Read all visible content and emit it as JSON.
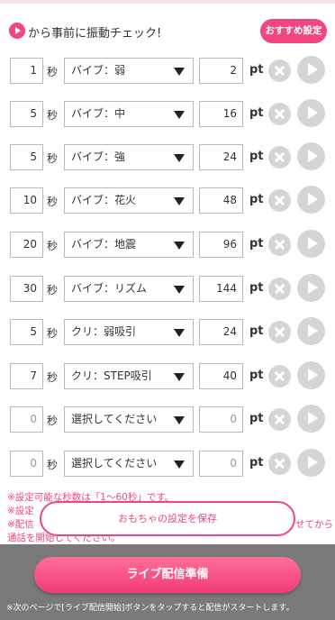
{
  "header": {
    "intro_text": "から事前に振動チェック!",
    "recommend_label": "おすすめ設定"
  },
  "units": {
    "sec": "秒",
    "pt": "pt"
  },
  "rows": [
    {
      "seconds": "1",
      "pattern": "バイブ：弱",
      "points": "2"
    },
    {
      "seconds": "5",
      "pattern": "バイブ：中",
      "points": "16"
    },
    {
      "seconds": "5",
      "pattern": "バイブ：強",
      "points": "24"
    },
    {
      "seconds": "10",
      "pattern": "バイブ：花火",
      "points": "48"
    },
    {
      "seconds": "20",
      "pattern": "バイブ：地震",
      "points": "96"
    },
    {
      "seconds": "30",
      "pattern": "バイブ：リズム",
      "points": "144"
    },
    {
      "seconds": "5",
      "pattern": "クリ：弱吸引",
      "points": "24"
    },
    {
      "seconds": "7",
      "pattern": "クリ：STEP吸引",
      "points": "40"
    },
    {
      "seconds": "0",
      "pattern": "選択してください",
      "points": "0"
    },
    {
      "seconds": "0",
      "pattern": "選択してください",
      "points": "0"
    }
  ],
  "notes": [
    "※設定可能な秒数は「1〜60秒」です。",
    "※設定",
    "※配信",
    "通話を開始してください。"
  ],
  "notes_tail": "せてから",
  "save_label": "おもちゃの設定を保存",
  "live_button_label": "ライブ配信準備",
  "footer_note": "※次のページで[ライブ配信開始]ボタンをタップすると配信がスタートします。",
  "colors": {
    "accent": "#f2467e",
    "disabled": "#d5d5d5"
  }
}
